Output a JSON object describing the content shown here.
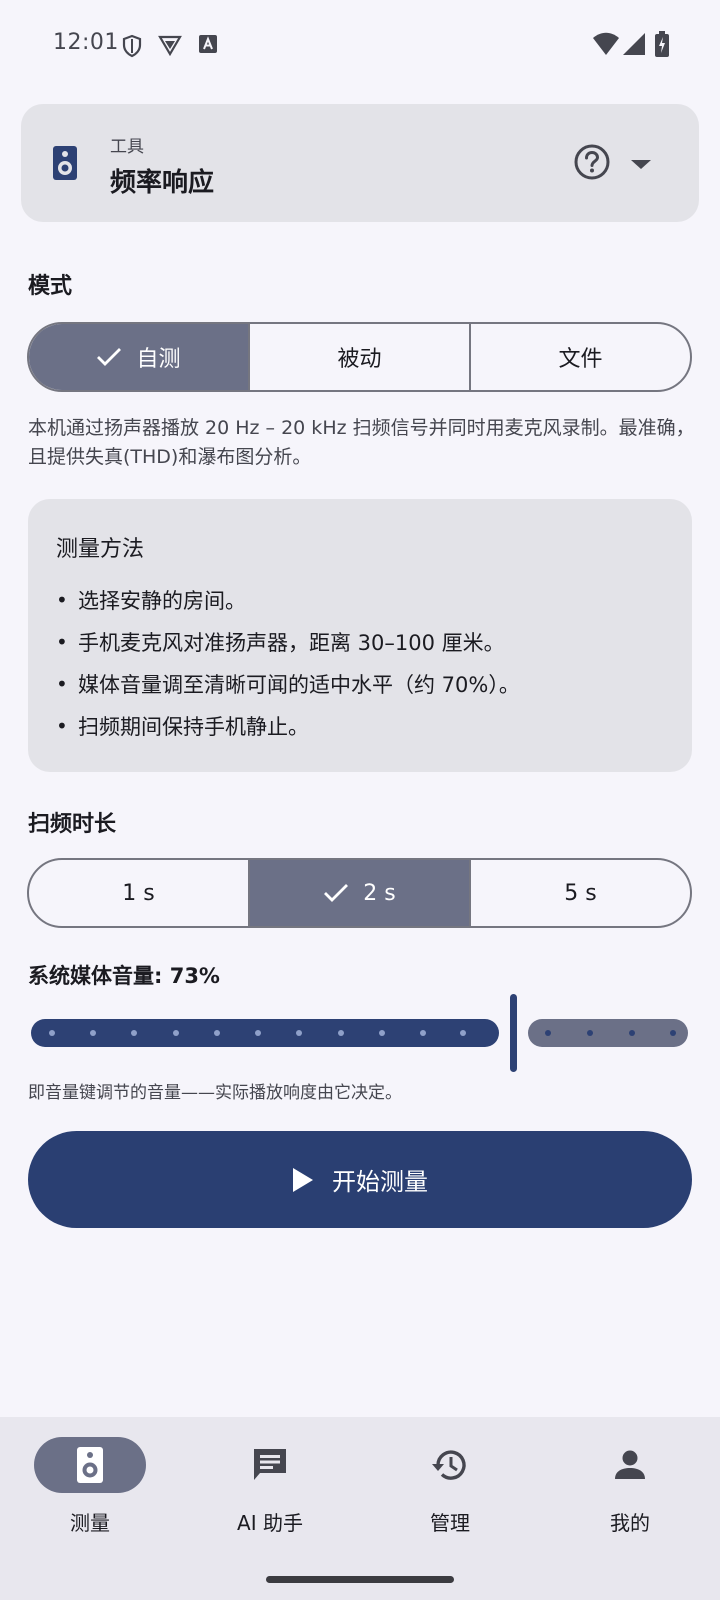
{
  "status": {
    "time": "12:01"
  },
  "tool": {
    "caption": "工具",
    "title": "频率响应"
  },
  "mode": {
    "label": "模式",
    "options": [
      "自测",
      "被动",
      "文件"
    ],
    "selected": "自测",
    "description": "本机通过扬声器播放 20 Hz – 20 kHz 扫频信号并同时用麦克风录制。最准确，且提供失真(THD)和瀑布图分析。"
  },
  "method": {
    "title": "测量方法",
    "items": [
      "选择安静的房间。",
      "手机麦克风对准扬声器，距离 30–100 厘米。",
      "媒体音量调至清晰可闻的适中水平（约 70%）。",
      "扫频期间保持手机静止。"
    ],
    "bullet": "•"
  },
  "sweep": {
    "label": "扫频时长",
    "options": [
      "1 s",
      "2 s",
      "5 s"
    ],
    "selected": "2 s"
  },
  "volume": {
    "label": "系统媒体音量: 73%",
    "value_percent": 73,
    "hint": "即音量键调节的音量——实际播放响度由它决定。"
  },
  "start_button": {
    "label": "开始测量"
  },
  "nav": {
    "items": [
      {
        "label": "测量",
        "icon": "speaker-icon",
        "active": true
      },
      {
        "label": "AI 助手",
        "icon": "chat-icon",
        "active": false
      },
      {
        "label": "管理",
        "icon": "history-icon",
        "active": false
      },
      {
        "label": "我的",
        "icon": "person-icon",
        "active": false
      }
    ]
  },
  "colors": {
    "primary": "#2a3f72",
    "selected_segment": "#6b7087",
    "card_bg": "#e3e3e8",
    "page_bg": "#f6f5fb"
  }
}
